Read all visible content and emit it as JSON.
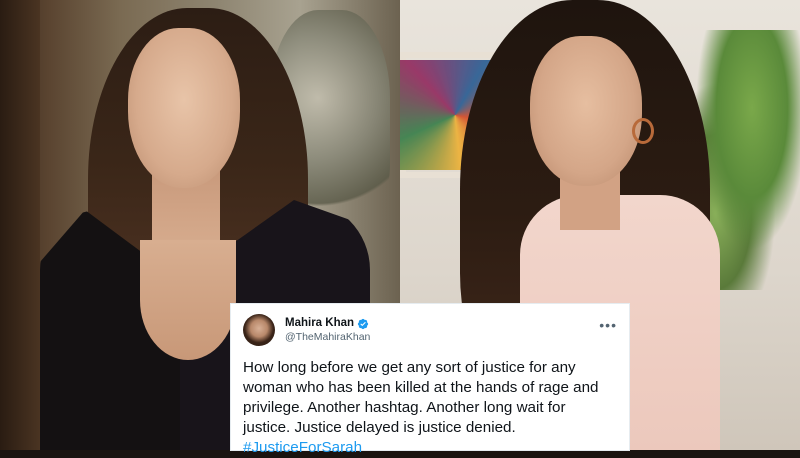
{
  "tweet": {
    "author": {
      "display_name": "Mahira Khan",
      "handle": "@TheMahiraKhan",
      "verified": true
    },
    "text": "How long before we get any sort of justice for any\nwoman who has been killed at the hands of rage and\nprivilege. Another hashtag. Another long wait for\njustice. Justice delayed is justice denied.",
    "hashtag": "#JusticeForSarah",
    "more_icon": "more-horizontal-icon"
  },
  "colors": {
    "hashtag": "#1d9bf0",
    "verified": "#1d9bf0",
    "text": "#0f1419",
    "handle": "#536471"
  }
}
